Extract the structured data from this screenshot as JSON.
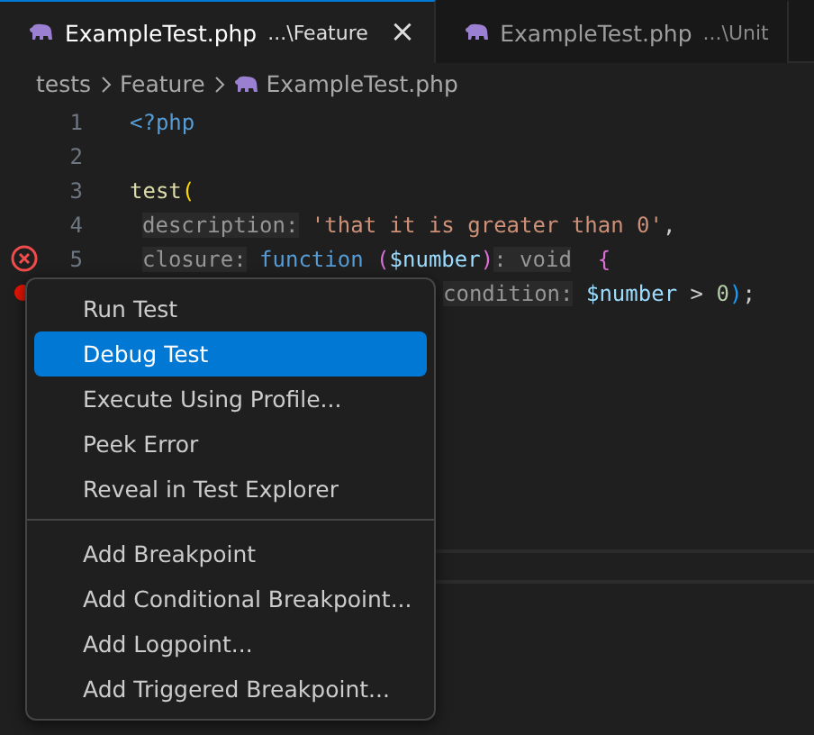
{
  "tabs": [
    {
      "label": "ExampleTest.php",
      "path": "...\\Feature",
      "selected": true,
      "close": "×"
    },
    {
      "label": "ExampleTest.php",
      "path": "...\\Unit",
      "selected": false
    }
  ],
  "breadcrumb": [
    "tests",
    "Feature",
    "ExampleTest.php"
  ],
  "code_lines": [
    {
      "number": "1",
      "indent": false,
      "error": false,
      "breakpoint": false,
      "partly_hidden": false,
      "tokens": [
        {
          "kind": "tag",
          "text": "<?php"
        }
      ]
    },
    {
      "number": "2",
      "error": false,
      "breakpoint": false
    },
    {
      "number": "3",
      "indent": false,
      "error": false,
      "breakpoint": false,
      "partly_hidden": false,
      "tokens": [
        {
          "kind": "fn",
          "text": "test"
        },
        {
          "kind": "paren",
          "text": "("
        }
      ]
    },
    {
      "number": "4",
      "indent": true,
      "error": false,
      "breakpoint": false,
      "partly_hidden": false,
      "tokens": [
        {
          "kind": "hint",
          "text": "description:"
        },
        {
          "kind": "string",
          "text": "'that it is greater than 0'"
        },
        {
          "kind": "plain",
          "text": ","
        }
      ]
    },
    {
      "number": "5",
      "indent": true,
      "error": true,
      "breakpoint": false,
      "partly_hidden": false,
      "tokens": [
        {
          "kind": "hint",
          "text": "closure:"
        },
        {
          "kind": "keyword",
          "text": "function"
        },
        {
          "kind": "paren2",
          "text": "("
        },
        {
          "kind": "var",
          "text": "$number"
        },
        {
          "kind": "paren2",
          "text": ")"
        },
        {
          "kind": "hint",
          "text": ": void"
        },
        {
          "kind": "brace",
          "text": "{"
        }
      ]
    },
    {
      "indent": true,
      "error": false,
      "breakpoint": true,
      "partly_hidden": true,
      "tokens": [
        {
          "kind": "hint",
          "text": "condition:"
        },
        {
          "kind": "var",
          "text": "$number"
        },
        {
          "kind": "op",
          "text": ">"
        },
        {
          "kind": "num",
          "text": "0"
        },
        {
          "kind": "paren3",
          "text": ")"
        },
        {
          "kind": "plain",
          "text": ";"
        }
      ]
    }
  ],
  "context_menu": [
    [
      {
        "label": "Run Test",
        "selected": false
      },
      {
        "label": "Debug Test",
        "selected": true
      },
      {
        "label": "Execute Using Profile...",
        "selected": false
      },
      {
        "label": "Peek Error",
        "selected": false
      },
      {
        "label": "Reveal in Test Explorer",
        "selected": false
      }
    ],
    [
      {
        "label": "Add Breakpoint",
        "selected": false
      },
      {
        "label": "Add Conditional Breakpoint...",
        "selected": false
      },
      {
        "label": "Add Logpoint...",
        "selected": false
      },
      {
        "label": "Add Triggered Breakpoint...",
        "selected": false
      }
    ]
  ]
}
